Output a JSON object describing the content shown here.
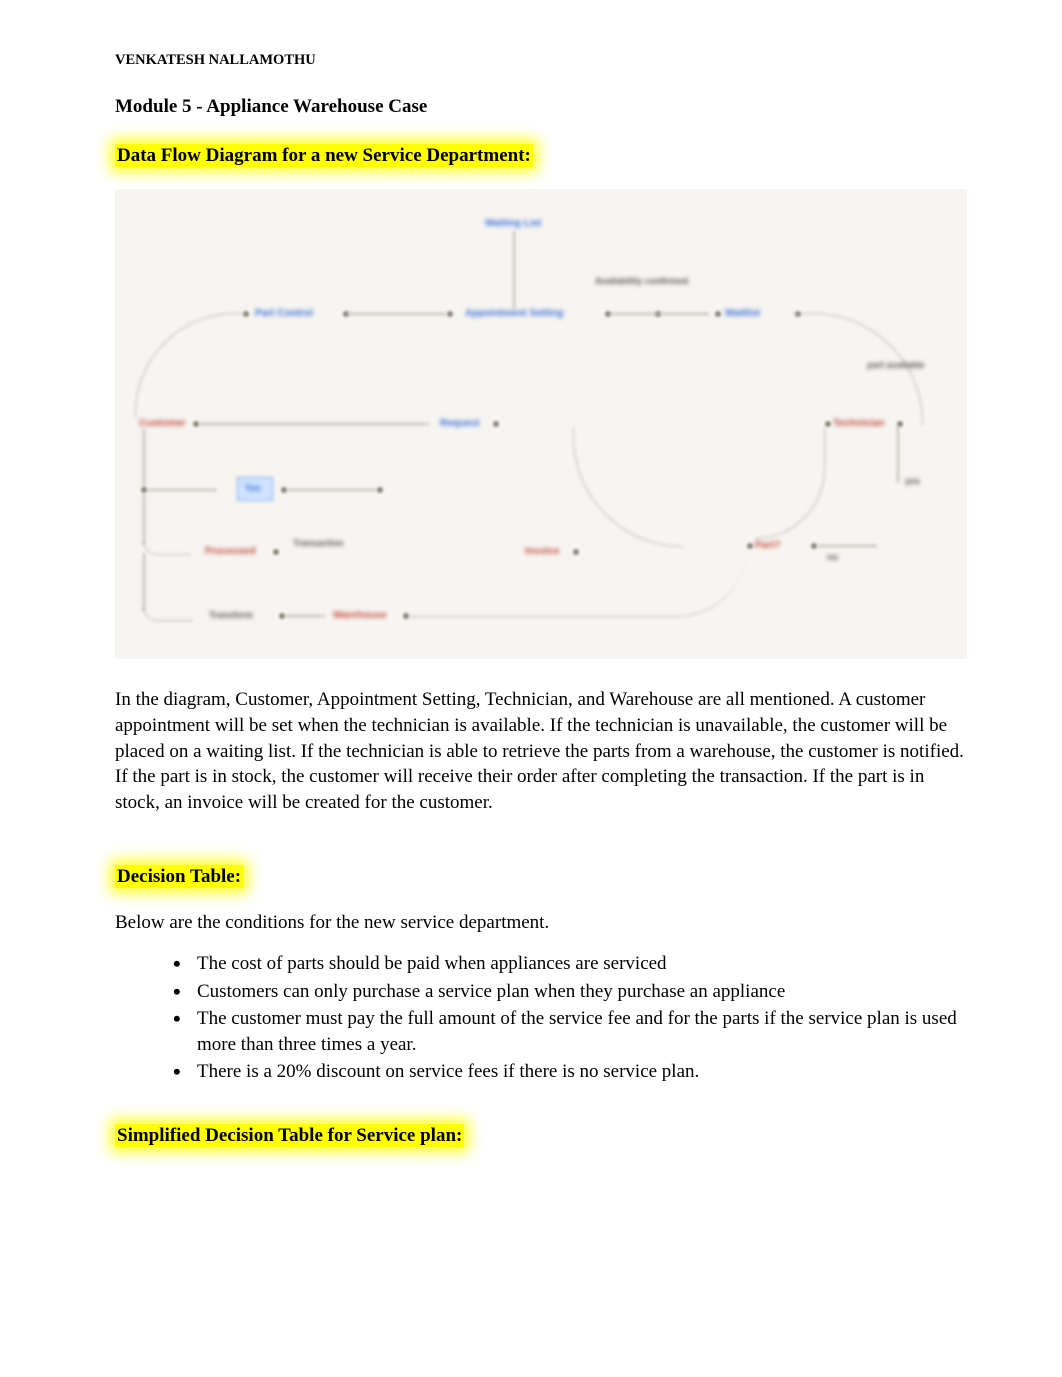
{
  "author": "VENKATESH NALLAMOTHU",
  "title": "Module 5 - Appliance Warehouse Case",
  "section1_heading": "Data Flow Diagram for a new Service Department:",
  "diagram": {
    "top_blue": "Waiting List",
    "mid_blue_left": "Part Control",
    "mid_blue_center": "Appointment Setting",
    "mid_blue_right": "Waitlist",
    "mid_gray_above": "Availability confirmed",
    "left_red": "Customer",
    "center_blue_req": "Request",
    "right_red": "Technician",
    "right_gray_small": "yes",
    "far_right_gray": "part available",
    "blue_box": "Yes",
    "lower_left_red": "Processed",
    "lower_left_gray": "Transaction",
    "lower_center_red": "Invoice",
    "lower_right_red": "Part?",
    "lower_right_gray": "no",
    "bottom_red": "Warehouse",
    "bottom_gray": "Transform"
  },
  "paragraph": "In the diagram, Customer, Appointment Setting, Technician, and Warehouse are all mentioned. A customer appointment will be set when the technician is available. If the technician is unavailable, the customer will be placed on a waiting list. If the technician is able to retrieve the parts from a warehouse, the customer is notified. If the part is in stock, the customer will receive their order after completing the transaction. If the part is in stock, an invoice will be created for the customer.",
  "section2_heading": "Decision Table:",
  "conditions_intro": "Below are the conditions for the new service department.",
  "conditions": [
    "The cost of parts should be paid when appliances are serviced",
    "Customers can only purchase a service plan when they purchase an appliance",
    "The customer must pay the full amount of the service fee and for the parts if the service plan is used more than three times a year.",
    "There is a 20% discount on service fees if there is no service plan."
  ],
  "section3_heading": "Simplified Decision Table for Service plan:"
}
